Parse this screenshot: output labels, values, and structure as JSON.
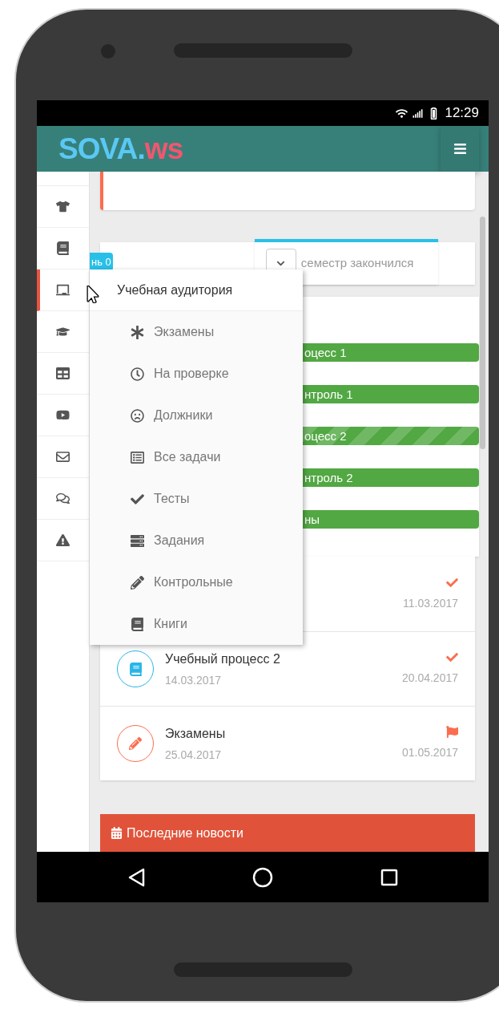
{
  "status_bar": {
    "time": "12:29"
  },
  "header": {
    "logo_main": "SOVA",
    "logo_dot": ".",
    "logo_suffix": "ws"
  },
  "sidebar": {
    "items": [
      {
        "kind": "shirt",
        "selected": false
      },
      {
        "kind": "book",
        "selected": false
      },
      {
        "kind": "board",
        "selected": true
      },
      {
        "kind": "cap",
        "selected": false
      },
      {
        "kind": "table",
        "selected": false
      },
      {
        "kind": "video",
        "selected": false
      },
      {
        "kind": "mail",
        "selected": false
      },
      {
        "kind": "chat",
        "selected": false
      },
      {
        "kind": "warning",
        "selected": false
      }
    ]
  },
  "level_card": {
    "badge": "нь 0",
    "semester_status": "семестр закончился"
  },
  "progress_bars": [
    {
      "label": "оцесс 1",
      "striped": false
    },
    {
      "label": "нтроль 1",
      "striped": false
    },
    {
      "label": "оцесс 2",
      "striped": true
    },
    {
      "label": "нтроль 2",
      "striped": false
    },
    {
      "label": "ны",
      "striped": false
    }
  ],
  "tasks": [
    {
      "end": "11.03.2017",
      "completed": true
    },
    {
      "kind": "book",
      "color": "#29b6e6",
      "title": "Учебный процесс 2",
      "start": "14.03.2017",
      "end": "20.04.2017",
      "completed": true
    },
    {
      "kind": "pencil",
      "color": "#fa6e4f",
      "title": "Экзамены",
      "start": "25.04.2017",
      "end": "01.05.2017",
      "completed": false
    }
  ],
  "news": {
    "title": "Последние новости"
  },
  "popup_menu": {
    "title": "Учебная аудитория",
    "items": [
      {
        "kind": "asterisk",
        "label": "Экзамены"
      },
      {
        "kind": "clock",
        "label": "На проверке"
      },
      {
        "kind": "frown",
        "label": "Должники"
      },
      {
        "kind": "list",
        "label": "Все задачи"
      },
      {
        "kind": "check",
        "label": "Тесты"
      },
      {
        "kind": "server",
        "label": "Задания"
      },
      {
        "kind": "pencil",
        "label": "Контрольные"
      },
      {
        "kind": "book",
        "label": "Книги"
      }
    ]
  }
}
